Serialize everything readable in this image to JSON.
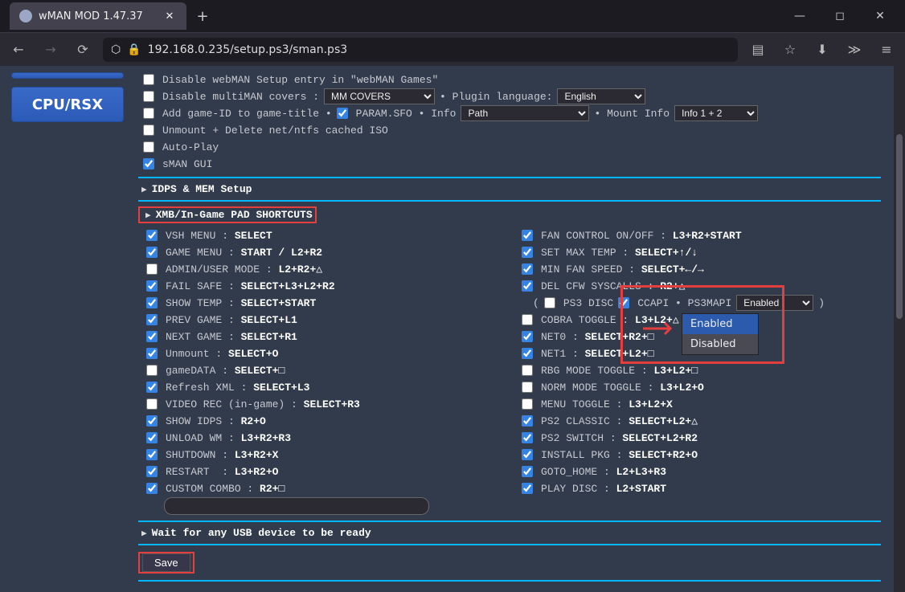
{
  "window": {
    "title": "wMAN MOD 1.47.37"
  },
  "url": {
    "display": "192.168.0.235/setup.ps3/sman.ps3"
  },
  "sidebar": {
    "cpu_rsx": "CPU/RSX"
  },
  "top_rows": {
    "disable_setup": "Disable webMAN Setup entry in \"webMAN Games\"",
    "disable_covers": "Disable multiMAN covers :",
    "covers_sel": "MM COVERS",
    "plugin_lang_lbl": "• Plugin language:",
    "plugin_lang_sel": "English",
    "add_gameid": "Add game-ID to game-title •",
    "param_sfo": "PARAM.SFO • Info",
    "info_sel": "Path",
    "mount_info_lbl": "• Mount Info",
    "mount_info_sel": "Info 1 + 2",
    "unmount_delete": "Unmount + Delete net/ntfs cached ISO",
    "auto_play": "Auto-Play",
    "sman_gui": "sMAN GUI"
  },
  "sections": {
    "idps": "IDPS & MEM Setup",
    "pad": "XMB/In-Game PAD SHORTCUTS",
    "usb": "Wait for any USB device to be ready"
  },
  "left": [
    {
      "c": true,
      "l": "VSH MENU : ",
      "b": "SELECT"
    },
    {
      "c": true,
      "l": "GAME MENU : ",
      "b": "START / L2+R2"
    },
    {
      "c": false,
      "l": "ADMIN/USER MODE : ",
      "b": "L2+R2+△"
    },
    {
      "c": true,
      "l": "FAIL SAFE : ",
      "b": "SELECT+L3+L2+R2"
    },
    {
      "c": true,
      "l": "SHOW TEMP : ",
      "b": "SELECT+START"
    },
    {
      "c": true,
      "l": "PREV GAME : ",
      "b": "SELECT+L1"
    },
    {
      "c": true,
      "l": "NEXT GAME : ",
      "b": "SELECT+R1"
    },
    {
      "c": true,
      "l": "Unmount : ",
      "b": "SELECT+O"
    },
    {
      "c": false,
      "l": "gameDATA : ",
      "b": "SELECT+□"
    },
    {
      "c": true,
      "l": "Refresh XML : ",
      "b": "SELECT+L3"
    },
    {
      "c": false,
      "l": "VIDEO REC (in-game) : ",
      "b": "SELECT+R3"
    },
    {
      "c": true,
      "l": "SHOW IDPS : ",
      "b": "R2+O"
    },
    {
      "c": true,
      "l": "UNLOAD WM : ",
      "b": "L3+R2+R3"
    },
    {
      "c": true,
      "l": "SHUTDOWN : ",
      "b": "L3+R2+X"
    },
    {
      "c": true,
      "l": "RESTART  : ",
      "b": "L3+R2+O"
    },
    {
      "c": true,
      "l": "CUSTOM COMBO : ",
      "b": "R2+□"
    }
  ],
  "right": [
    {
      "c": true,
      "l": "FAN CONTROL ON/OFF : ",
      "b": "L3+R2+START"
    },
    {
      "c": true,
      "l": "SET MAX TEMP : ",
      "b": "SELECT+↑/↓"
    },
    {
      "c": true,
      "l": "MIN FAN SPEED : ",
      "b": "SELECT+←/→"
    },
    {
      "c": true,
      "l": "DEL CFW SYSCALLS : ",
      "b": "R2+△"
    }
  ],
  "ccapi": {
    "open": "(",
    "ps3disc": "PS3 DISC",
    "ccapi": "CCAPI • PS3MAPI",
    "close": ")",
    "sel": "Enabled"
  },
  "right2": [
    {
      "c": false,
      "l": "COBRA TOGGLE : ",
      "b": "L3+L2+△"
    },
    {
      "c": true,
      "l": "NET0 : ",
      "b": "SELECT+R2+□"
    },
    {
      "c": true,
      "l": "NET1 : ",
      "b": "SELECT+L2+□"
    },
    {
      "c": false,
      "l": "RBG MODE TOGGLE : ",
      "b": "L3+L2+□"
    },
    {
      "c": false,
      "l": "NORM MODE TOGGLE : ",
      "b": "L3+L2+O"
    },
    {
      "c": false,
      "l": "MENU TOGGLE : ",
      "b": "L3+L2+X"
    },
    {
      "c": true,
      "l": "PS2 CLASSIC : ",
      "b": "SELECT+L2+△"
    },
    {
      "c": true,
      "l": "PS2 SWITCH : ",
      "b": "SELECT+L2+R2"
    },
    {
      "c": true,
      "l": "INSTALL PKG : ",
      "b": "SELECT+R2+O"
    },
    {
      "c": true,
      "l": "GOTO_HOME : ",
      "b": "L2+L3+R3"
    },
    {
      "c": true,
      "l": "PLAY DISC : ",
      "b": "L2+START"
    }
  ],
  "dropdown": {
    "opt1": "Enabled",
    "opt2": "Disabled"
  },
  "save": "Save"
}
